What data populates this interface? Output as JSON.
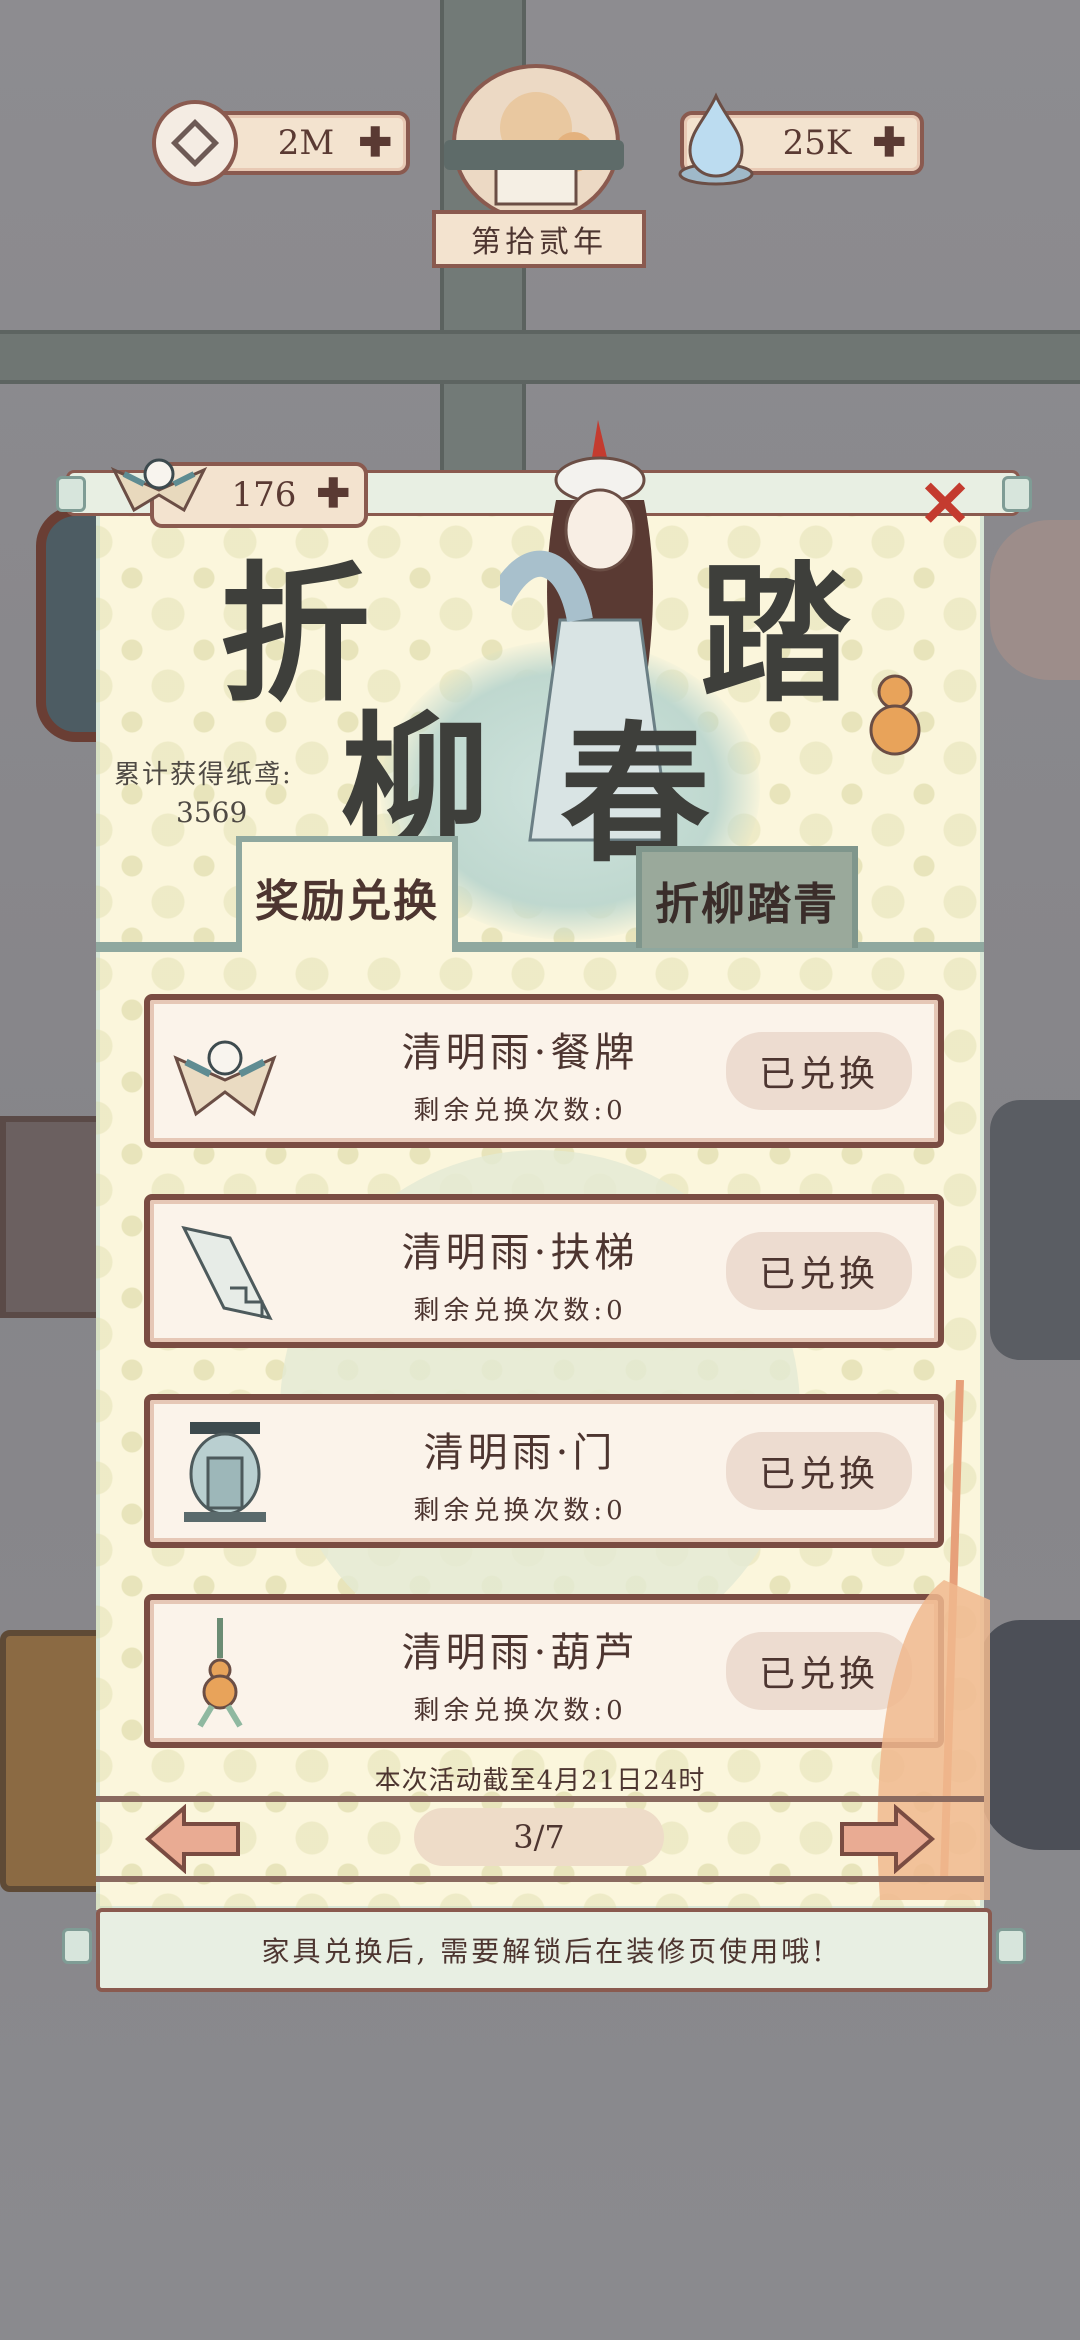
{
  "resources": {
    "coins": "2M",
    "water": "25K",
    "year": "第拾贰年"
  },
  "event": {
    "kite_count": "176",
    "title_chars": [
      "折",
      "柳",
      "踏",
      "春"
    ],
    "total_label": "累计获得纸鸢:",
    "total_value": "3569"
  },
  "tabs": {
    "active": "奖励兑换",
    "inactive": "折柳踏青"
  },
  "rewards": [
    {
      "name": "清明雨·餐牌",
      "remaining": "剩余兑换次数:0",
      "button": "已兑换",
      "icon": "kite-icon"
    },
    {
      "name": "清明雨·扶梯",
      "remaining": "剩余兑换次数:0",
      "button": "已兑换",
      "icon": "ladder-icon"
    },
    {
      "name": "清明雨·门",
      "remaining": "剩余兑换次数:0",
      "button": "已兑换",
      "icon": "door-icon"
    },
    {
      "name": "清明雨·葫芦",
      "remaining": "剩余兑换次数:0",
      "button": "已兑换",
      "icon": "gourd-icon"
    }
  ],
  "deadline": "本次活动截至4月21日24时",
  "pagination": "3/7",
  "tip": "家具兑换后, 需要解锁后在装修页使用哦!",
  "colors": {
    "panel": "#fbf6dc",
    "frame": "#7a4c42",
    "close": "#c43b2f",
    "tab_accent": "#8fa89f"
  }
}
